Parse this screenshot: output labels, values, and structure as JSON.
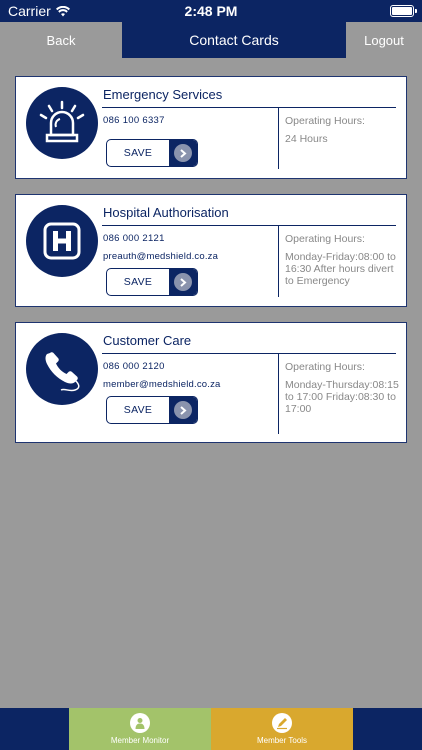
{
  "status_bar": {
    "carrier": "Carrier",
    "time": "2:48 PM"
  },
  "nav": {
    "back_label": "Back",
    "title": "Contact Cards",
    "logout_label": "Logout"
  },
  "cards": [
    {
      "title": "Emergency Services",
      "phone": "086 100 6337",
      "email": "",
      "hours_label": "Operating Hours:",
      "hours": "24 Hours",
      "save_label": "SAVE",
      "icon": "siren-icon"
    },
    {
      "title": "Hospital Authorisation",
      "phone": "086 000 2121",
      "email": "preauth@medshield.co.za",
      "hours_label": "Operating Hours:",
      "hours": "Monday-Friday:08:00 to 16:30 After hours divert to Emergency",
      "save_label": "SAVE",
      "icon": "hospital-icon"
    },
    {
      "title": "Customer Care",
      "phone": "086 000 2120",
      "email": "member@medshield.co.za",
      "hours_label": "Operating Hours:",
      "hours": "Monday-Thursday:08:15 to 17:00 Friday:08:30 to 17:00",
      "save_label": "SAVE",
      "icon": "telephone-icon"
    }
  ],
  "tabs": {
    "monitor_label": "Member Monitor",
    "tools_label": "Member Tools"
  },
  "colors": {
    "brand_navy": "#0c2563",
    "background_grey": "#9a9a9a",
    "monitor_green": "#a3c36a",
    "tools_gold": "#d9a82e"
  }
}
